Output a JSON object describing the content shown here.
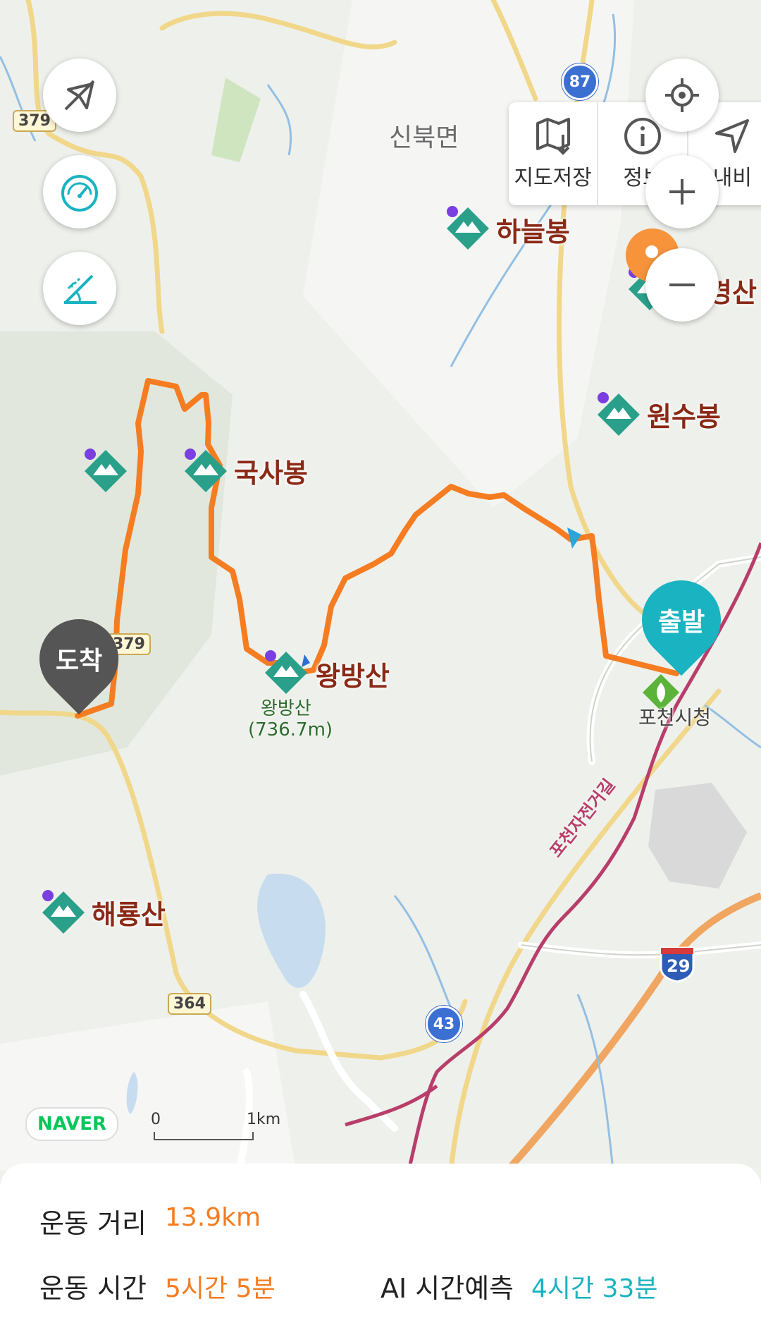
{
  "map": {
    "places": {
      "sinbuk": "신북면",
      "haneulbong": "하늘봉",
      "gyeongsan": "경산",
      "wonsubong": "원수봉",
      "guksabong": "국사봉",
      "wangbangsan": "왕방산",
      "wangbangsan_summit": "왕방산",
      "wangbangsan_elev": "(736.7m)",
      "haeryongsan": "해룡산",
      "pocheon_cityhall": "포천시청",
      "bike_road": "포천자전거길"
    },
    "roads": {
      "r379a": "379",
      "r379b": "379",
      "r364": "364",
      "hw87": "87",
      "hw43": "43",
      "hw29": "29"
    },
    "markers": {
      "start": "출발",
      "end": "도착"
    },
    "toolbar": {
      "save_map": "지도저장",
      "info": "정보",
      "nav": "내비"
    },
    "brand": "NAVER",
    "scale": {
      "zero": "0",
      "one": "1km"
    },
    "colors": {
      "route": "#f57c21",
      "marker_start": "#1ab3c1",
      "marker_end": "#555555",
      "peak": "#2aa08a"
    }
  },
  "stats": {
    "distance_label": "운동 거리",
    "distance_value": "13.9km",
    "time_label": "운동 시간",
    "time_value": "5시간 5분",
    "ai_label": "AI 시간예측",
    "ai_value": "4시간 33분"
  }
}
